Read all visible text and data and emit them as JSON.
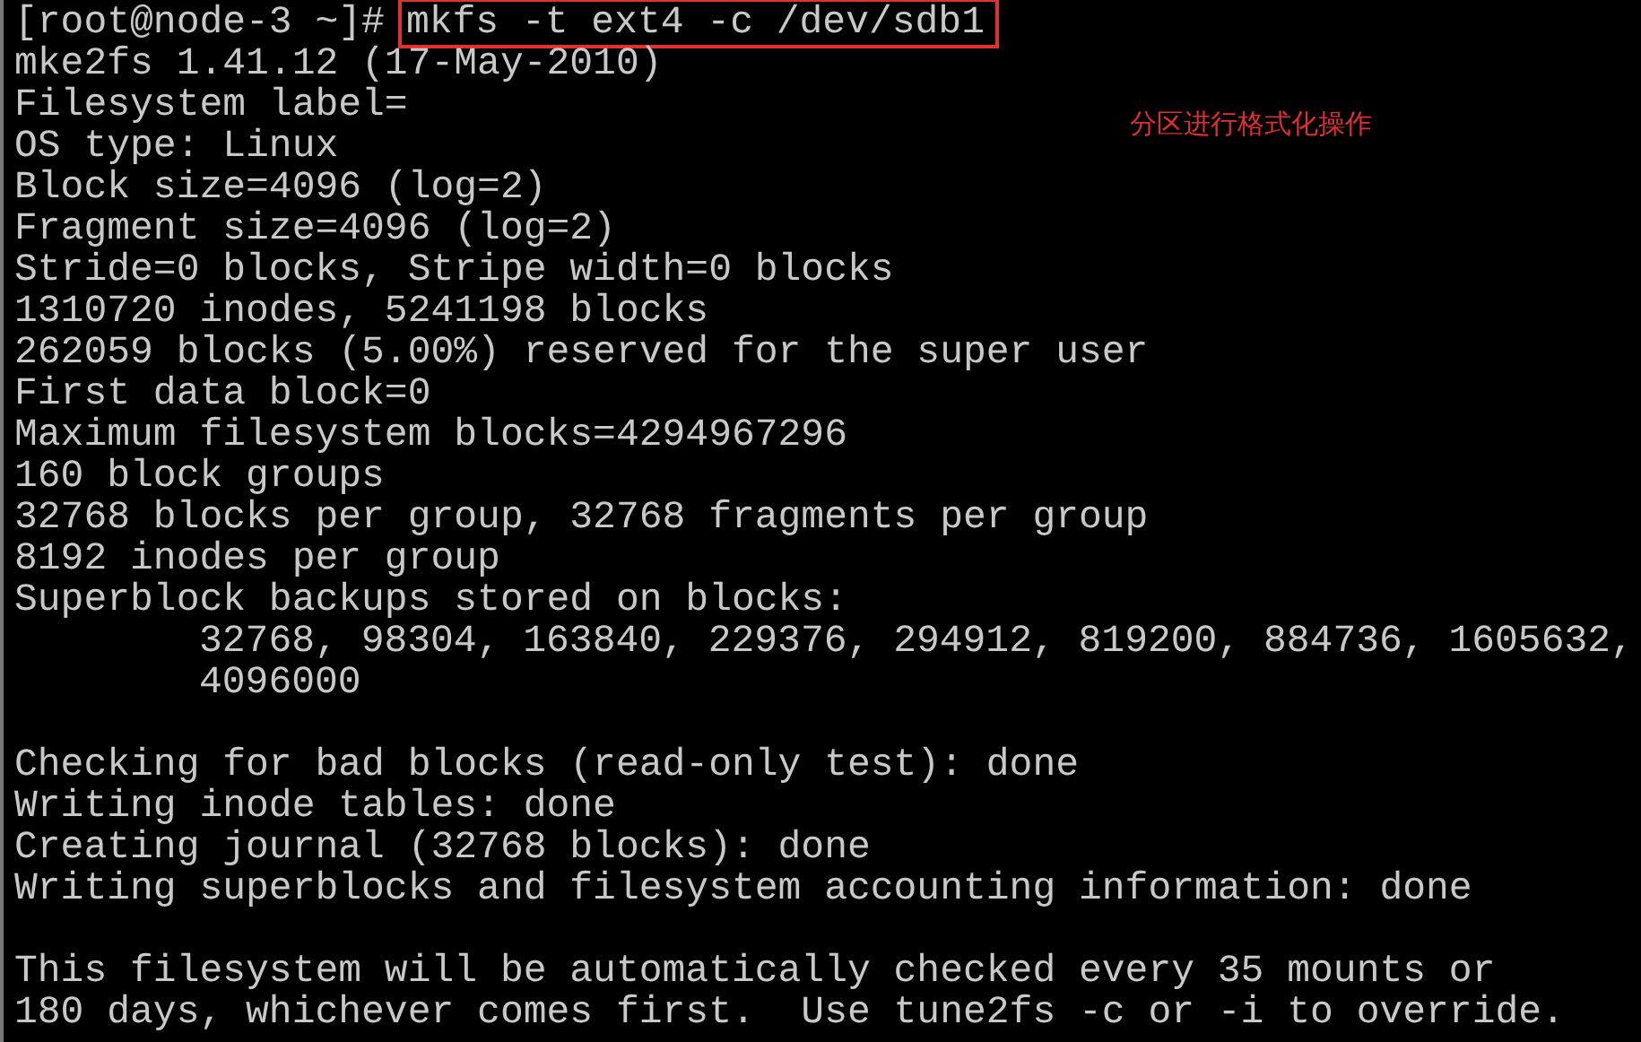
{
  "terminal": {
    "lines": [
      {
        "kind": "prompt",
        "prompt": "[root@node-3 ~]#",
        "command": "mkfs -t ext4 -c /dev/sdb1"
      },
      {
        "kind": "output",
        "text": "mke2fs 1.41.12 (17-May-2010)"
      },
      {
        "kind": "output",
        "text": "Filesystem label="
      },
      {
        "kind": "output",
        "text": "OS type: Linux"
      },
      {
        "kind": "output",
        "text": "Block size=4096 (log=2)"
      },
      {
        "kind": "output",
        "text": "Fragment size=4096 (log=2)"
      },
      {
        "kind": "output",
        "text": "Stride=0 blocks, Stripe width=0 blocks"
      },
      {
        "kind": "output",
        "text": "1310720 inodes, 5241198 blocks"
      },
      {
        "kind": "output",
        "text": "262059 blocks (5.00%) reserved for the super user"
      },
      {
        "kind": "output",
        "text": "First data block=0"
      },
      {
        "kind": "output",
        "text": "Maximum filesystem blocks=4294967296"
      },
      {
        "kind": "output",
        "text": "160 block groups"
      },
      {
        "kind": "output",
        "text": "32768 blocks per group, 32768 fragments per group"
      },
      {
        "kind": "output",
        "text": "8192 inodes per group"
      },
      {
        "kind": "output",
        "text": "Superblock backups stored on blocks:"
      },
      {
        "kind": "indented",
        "text": "32768, 98304, 163840, 229376, 294912, 819200, 884736, 1605632,"
      },
      {
        "kind": "indented",
        "text": "4096000"
      },
      {
        "kind": "blank"
      },
      {
        "kind": "output",
        "text": "Checking for bad blocks (read-only test): done"
      },
      {
        "kind": "output",
        "text": "Writing inode tables: done"
      },
      {
        "kind": "output",
        "text": "Creating journal (32768 blocks): done"
      },
      {
        "kind": "output",
        "text": "Writing superblocks and filesystem accounting information: done"
      },
      {
        "kind": "blank"
      },
      {
        "kind": "output",
        "text": "This filesystem will be automatically checked every 35 mounts or"
      },
      {
        "kind": "output",
        "text": "180 days, whichever comes first.  Use tune2fs -c or -i to override."
      }
    ]
  },
  "annotation": "分区进行格式化操作"
}
